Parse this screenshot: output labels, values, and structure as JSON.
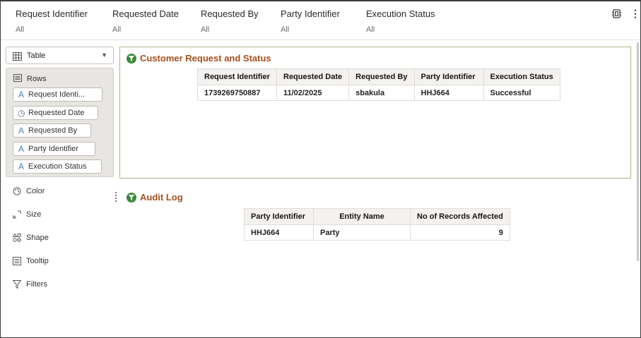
{
  "filters": [
    {
      "label": "Request Identifier",
      "value": "All"
    },
    {
      "label": "Requested Date",
      "value": "All"
    },
    {
      "label": "Requested By",
      "value": "All"
    },
    {
      "label": "Party Identifier",
      "value": "All"
    },
    {
      "label": "Execution Status",
      "value": "All"
    }
  ],
  "toolbar": {
    "icons": [
      "settings-icon",
      "more-vertical-icon"
    ],
    "more_glyph": "⋮"
  },
  "viz_type": {
    "label": "Table"
  },
  "rows": {
    "label": "Rows",
    "items": [
      {
        "label": "Request Identi...",
        "icon": "text-attribute-icon",
        "glyph": "A"
      },
      {
        "label": "Requested Date",
        "icon": "clock-icon",
        "glyph": "◷"
      },
      {
        "label": "Requested By",
        "icon": "text-attribute-icon",
        "glyph": "A"
      },
      {
        "label": "Party Identifier",
        "icon": "text-attribute-icon",
        "glyph": "A"
      },
      {
        "label": "Execution Status",
        "icon": "text-attribute-icon",
        "glyph": "A"
      }
    ]
  },
  "grammar": [
    {
      "label": "Color",
      "icon": "palette-icon"
    },
    {
      "label": "Size",
      "icon": "resize-icon"
    },
    {
      "label": "Shape",
      "icon": "shape-icon"
    },
    {
      "label": "Tooltip",
      "icon": "tooltip-icon"
    },
    {
      "label": "Filters",
      "icon": "filter-icon"
    }
  ],
  "customer_request": {
    "title": "Customer Request and Status",
    "columns": [
      "Request Identifier",
      "Requested Date",
      "Requested By",
      "Party Identifier",
      "Execution Status"
    ],
    "rows": [
      [
        "1739269750887",
        "11/02/2025",
        "sbakula",
        "HHJ664",
        "Successful"
      ]
    ]
  },
  "audit_log": {
    "title": "Audit Log",
    "columns": [
      "Party Identifier",
      "Entity Name",
      "No of Records Affected"
    ],
    "rows": [
      [
        "HHJ664",
        "Party",
        "9"
      ]
    ]
  },
  "colors": {
    "title": "#a5501c",
    "title_icon": "#3b8a3a",
    "viz_border": "#b3b28d",
    "panel_bg": "#e8e6e2"
  }
}
